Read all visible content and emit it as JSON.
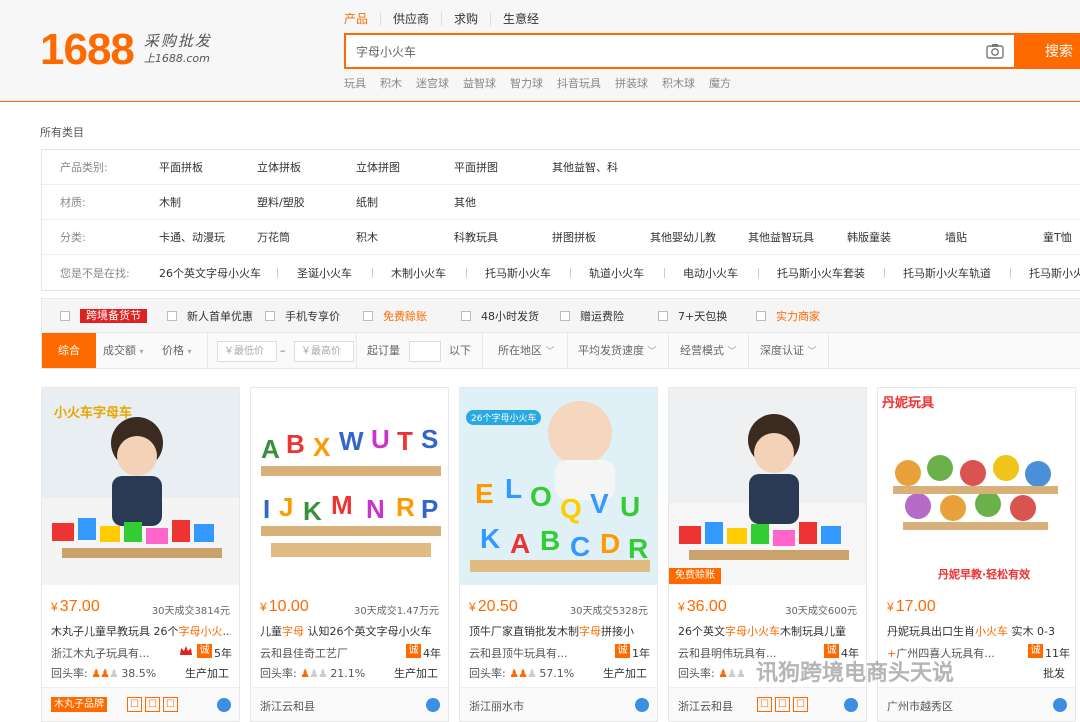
{
  "header": {
    "logo_number": "1688",
    "logo_slogan": "采购批发",
    "logo_url": "上1688.com",
    "search_tabs": [
      "产品",
      "供应商",
      "求购",
      "生意经"
    ],
    "search_value": "字母小火车",
    "search_button": "搜索",
    "hot_words": [
      "玩具",
      "积木",
      "迷宫球",
      "益智球",
      "智力球",
      "抖音玩具",
      "拼装球",
      "积木球",
      "魔方"
    ]
  },
  "breadcrumb": "所有类目",
  "filters": {
    "category_label": "产品类别:",
    "categories": [
      "平面拼板",
      "立体拼板",
      "立体拼图",
      "平面拼图",
      "其他益智、科"
    ],
    "material_label": "材质:",
    "materials": [
      "木制",
      "塑料/塑胶",
      "纸制",
      "其他"
    ],
    "class_label": "分类:",
    "classes": [
      "卡通、动漫玩",
      "万花筒",
      "积木",
      "科教玩具",
      "拼图拼板",
      "其他婴幼儿教",
      "其他益智玩具",
      "韩版童装",
      "墙贴",
      "童T恤"
    ],
    "suggest_label": "您是不是在找:",
    "suggests": [
      "26个英文字母小火车",
      "圣诞小火车",
      "木制小火车",
      "托马斯小火车",
      "轨道小火车",
      "电动小火车",
      "托马斯小火车套装",
      "托马斯小火车轨道",
      "托马斯小火"
    ]
  },
  "services": [
    "跨境备货节",
    "新人首单优惠",
    "手机专享价",
    "免费赊账",
    "48小时发货",
    "赠运费险",
    "7+天包换",
    "实力商家"
  ],
  "sort": {
    "comprehensive": "综合",
    "volume": "成交额",
    "price": "价格",
    "min_price": "￥最低价",
    "dash": "–",
    "max_price": "￥最高价",
    "moq": "起订量",
    "below": "以下",
    "location": "所在地区",
    "ship_speed": "平均发货速度",
    "biz_mode": "经营模式",
    "cert": "深度认证"
  },
  "products": [
    {
      "price": "37.00",
      "sold": "30天成交3814元",
      "title_pre": "木丸子儿童早教玩具 26个",
      "title_hl": "字母小火",
      "title_post": "",
      "company": "浙江木丸子玩具有...",
      "years": "5年",
      "rate": "38.5%",
      "mode": "生产加工",
      "location": "木丸子品牌",
      "img_text": "小火车字母车"
    },
    {
      "price": "10.00",
      "sold": "30天成交1.47万元",
      "title_pre": "儿童",
      "title_hl": "字母",
      "title_post": " 认知26个英文字母小火车",
      "company": "云和县佳奇工艺厂",
      "years": "4年",
      "rate": "21.1%",
      "mode": "生产加工",
      "location": "浙江云和县",
      "img_text": ""
    },
    {
      "price": "20.50",
      "sold": "30天成交5328元",
      "title_pre": "顶牛厂家直销批发木制",
      "title_hl": "字母",
      "title_post": "拼接小",
      "company": "云和县顶牛玩具有...",
      "years": "1年",
      "rate": "57.1%",
      "mode": "生产加工",
      "location": "浙江丽水市",
      "img_text": "26个字母小火车"
    },
    {
      "price": "36.00",
      "sold": "30天成交600元",
      "title_pre": "26个英文",
      "title_hl": "字母小火车",
      "title_post": "木制玩具儿童",
      "company": "云和县明伟玩具有...",
      "years": "4年",
      "rate": "",
      "mode": "",
      "location": "浙江云和县",
      "img_text": "免费赊账"
    },
    {
      "price": "17.00",
      "sold": "",
      "title_pre": "丹妮玩具出口生肖",
      "title_hl": "小火车",
      "title_post": " 实木 0-3",
      "company": "广州四喜人玩具有...",
      "years": "11年",
      "rate": "",
      "mode": "批发",
      "location": "广州市越秀区",
      "img_text": "丹妮玩具"
    }
  ],
  "watermark": "讯狗跨境电商头天说",
  "colors": {
    "accent": "#ff6a00",
    "badge_red": "#dd2222",
    "chat_blue": "#3a8fe0"
  }
}
